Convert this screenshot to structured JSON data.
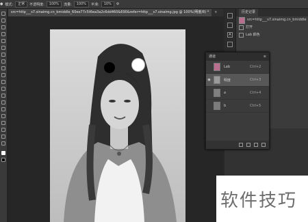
{
  "options_bar": {
    "mode_label": "模式:",
    "mode_value": "正常",
    "opacity_label": "不透明度:",
    "opacity_value": "100%",
    "flow_label": "流量:",
    "flow_value": "100%",
    "smoothing_label": "平滑:",
    "smoothing_value": "10%"
  },
  "tabs": [
    {
      "label": "src=http___s7.sinaimg.cn_bmiddle_60ee77c5t6ea3a2c6dd460&690&refer=http___s7.sinaimg.jpg @ 100%(明度/8) *",
      "active": false
    },
    {
      "label": "×",
      "active": false
    }
  ],
  "history_panel": {
    "tab_label": "历史记录",
    "snapshot_label": "src=http___s7.sinaimg.cn_bmiddle",
    "items": [
      "打开",
      "Lab 颜色"
    ]
  },
  "channels_panel": {
    "title": "通道",
    "channels": [
      {
        "name": "Lab",
        "shortcut": "Ctrl+2",
        "selected": false
      },
      {
        "name": "明度",
        "shortcut": "Ctrl+3",
        "selected": true
      },
      {
        "name": "a",
        "shortcut": "Ctrl+4",
        "selected": false
      },
      {
        "name": "b",
        "shortcut": "Ctrl+5",
        "selected": false
      }
    ]
  },
  "watermark": {
    "text": "软件技巧"
  },
  "colors": {
    "selected_row": "#575757",
    "lab_thumb": "#b86e8e"
  }
}
